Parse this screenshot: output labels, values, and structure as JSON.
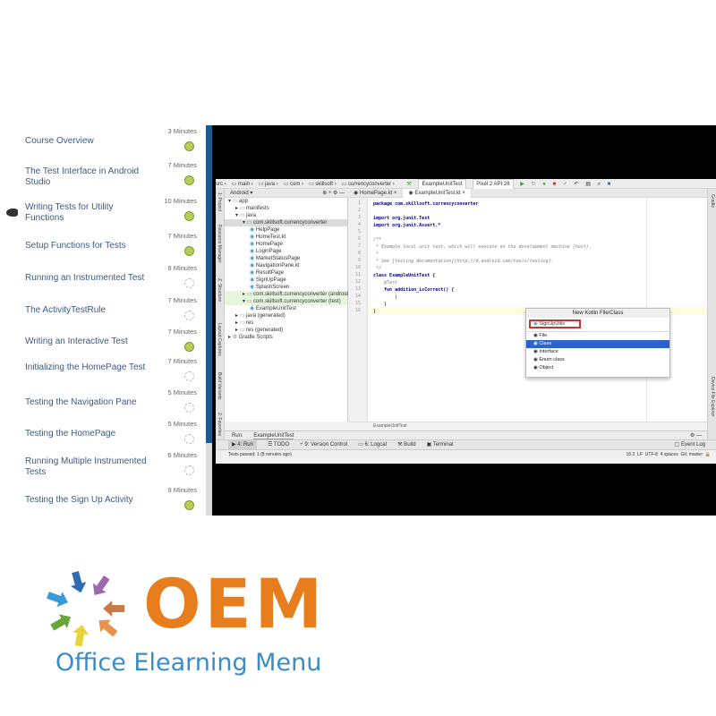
{
  "course_toc": {
    "items": [
      {
        "title": "Course Overview",
        "duration": "3 Minutes",
        "status": "completed"
      },
      {
        "title": "The Test Interface in Android Studio",
        "duration": "7 Minutes",
        "status": "completed"
      },
      {
        "title": "Writing Tests for Utility Functions",
        "duration": "10 Minutes",
        "status": "completed",
        "current": true
      },
      {
        "title": "Setup Functions for Tests",
        "duration": "7 Minutes",
        "status": "completed"
      },
      {
        "title": "Running an Instrumented Test",
        "duration": "8 Minutes",
        "status": "not-started"
      },
      {
        "title": "The ActivityTestRule",
        "duration": "7 Minutes",
        "status": "not-started"
      },
      {
        "title": "Writing an Interactive Test",
        "duration": "7 Minutes",
        "status": "completed"
      },
      {
        "title": "Initializing the HomePage Test",
        "duration": "7 Minutes",
        "status": "not-started"
      },
      {
        "title": "Testing the Navigation Pane",
        "duration": "5 Minutes",
        "status": "not-started"
      },
      {
        "title": "Testing the HomePage",
        "duration": "5 Minutes",
        "status": "not-started"
      },
      {
        "title": "Running Multiple Instrumented Tests",
        "duration": "6 Minutes",
        "status": "not-started"
      },
      {
        "title": "Testing the Sign Up Activity",
        "duration": "9 Minutes",
        "status": "completed"
      }
    ]
  },
  "ide": {
    "breadcrumb": [
      "src",
      "main",
      "java",
      "com",
      "skillsoft",
      "currencyconverter"
    ],
    "run_config": "ExampleUnitTest",
    "device": "Pixel 2 API 28",
    "project_view": "Android",
    "left_tool_tabs": [
      "1: Project",
      "Resource Manager",
      "Z: Structure",
      "Layout Captures",
      "Build Variants",
      "2: Favorites"
    ],
    "right_tool_tabs": [
      "Gradle",
      "Device File Explorer"
    ],
    "tree": [
      {
        "label": "app",
        "indent": 0,
        "icon": "folder",
        "arrow": "▾"
      },
      {
        "label": "manifests",
        "indent": 1,
        "icon": "folder",
        "arrow": "▸"
      },
      {
        "label": "java",
        "indent": 1,
        "icon": "folder",
        "arrow": "▾"
      },
      {
        "label": "com.skillsoft.currencyconverter",
        "indent": 2,
        "icon": "package",
        "arrow": "▾",
        "selected": true
      },
      {
        "label": "HelpPage",
        "indent": 3,
        "icon": "class"
      },
      {
        "label": "HomeTest.kt",
        "indent": 3,
        "icon": "kt"
      },
      {
        "label": "HomePage",
        "indent": 3,
        "icon": "class"
      },
      {
        "label": "LoginPage",
        "indent": 3,
        "icon": "class"
      },
      {
        "label": "MarketStatusPage",
        "indent": 3,
        "icon": "class"
      },
      {
        "label": "NavigationPane.kt",
        "indent": 3,
        "icon": "kt"
      },
      {
        "label": "ResultPage",
        "indent": 3,
        "icon": "class"
      },
      {
        "label": "SignUpPage",
        "indent": 3,
        "icon": "class"
      },
      {
        "label": "SplashScreen",
        "indent": 3,
        "icon": "class"
      },
      {
        "label": "com.skillsoft.currencyconverter (androidTest)",
        "indent": 2,
        "icon": "package",
        "arrow": "▸",
        "test": true
      },
      {
        "label": "com.skillsoft.currencyconverter (test)",
        "indent": 2,
        "icon": "package",
        "arrow": "▾",
        "test": true
      },
      {
        "label": "ExampleUnitTest",
        "indent": 3,
        "icon": "class"
      },
      {
        "label": "java (generated)",
        "indent": 1,
        "icon": "folder",
        "arrow": "▸"
      },
      {
        "label": "res",
        "indent": 1,
        "icon": "folder",
        "arrow": "▸"
      },
      {
        "label": "res (generated)",
        "indent": 1,
        "icon": "folder",
        "arrow": "▸"
      },
      {
        "label": "Gradle Scripts",
        "indent": 0,
        "icon": "gradle",
        "arrow": "▸"
      }
    ],
    "editor_tabs": [
      {
        "label": "HomePage.kt",
        "active": false
      },
      {
        "label": "ExampleUnitTest.kt",
        "active": true
      }
    ],
    "code_lines": [
      {
        "n": "1",
        "text": "package com.skillsoft.currencyconverter",
        "kind": "kw"
      },
      {
        "n": "2",
        "text": "",
        "kind": ""
      },
      {
        "n": "3",
        "text": "import org.junit.Test",
        "kind": "kw"
      },
      {
        "n": "4",
        "text": "import org.junit.Assert.*",
        "kind": "kw"
      },
      {
        "n": "5",
        "text": "",
        "kind": ""
      },
      {
        "n": "6",
        "text": "/**",
        "kind": "cm"
      },
      {
        "n": "7",
        "text": " * Example local unit test, which will execute on the development machine (host).",
        "kind": "cm"
      },
      {
        "n": "8",
        "text": " *",
        "kind": "cm"
      },
      {
        "n": "9",
        "text": " * See [testing documentation](http://d.android.com/tools/testing).",
        "kind": "cm"
      },
      {
        "n": "10",
        "text": " */",
        "kind": "cm"
      },
      {
        "n": "11",
        "text": "class ExampleUnitTest {",
        "kind": "kw"
      },
      {
        "n": "12",
        "text": "    @Test",
        "kind": "cm"
      },
      {
        "n": "13",
        "text": "    fun addition_isCorrect() {",
        "kind": "kw"
      },
      {
        "n": "14",
        "text": "        |",
        "kind": ""
      },
      {
        "n": "15",
        "text": "    }",
        "kind": ""
      },
      {
        "n": "16",
        "text": "}",
        "kind": ""
      }
    ],
    "editor_footer": "ExampleUnitTest",
    "popup": {
      "title": "New Kotlin File/Class",
      "input_value": "SignUpUtils",
      "options": [
        {
          "label": "File",
          "selected": false
        },
        {
          "label": "Class",
          "selected": true
        },
        {
          "label": "Interface",
          "selected": false
        },
        {
          "label": "Enum class",
          "selected": false
        },
        {
          "label": "Object",
          "selected": false
        }
      ]
    },
    "run_bar": {
      "label": "Run:",
      "config": "ExampleUnitTest"
    },
    "bottom_tabs": [
      {
        "label": "▶ 4: Run",
        "active": true
      },
      {
        "label": "☰ TODO",
        "active": false
      },
      {
        "label": "⑂ 9: Version Control",
        "active": false
      },
      {
        "label": "▭ 6: Logcat",
        "active": false
      },
      {
        "label": "⚒ Build",
        "active": false
      },
      {
        "label": "▣ Terminal",
        "active": false
      }
    ],
    "event_log": "Event Log",
    "status": {
      "message": "Tests passed: 1 (8 minutes ago)",
      "position": "16:2",
      "line_sep": "LF",
      "encoding": "UTF-8",
      "indent": "4 spaces",
      "vcs": "Git: master"
    }
  },
  "logo": {
    "brand": "OEM",
    "subtitle": "Office Elearning Menu",
    "arrow_colors": [
      "#c97a4a",
      "#9b6bb0",
      "#2f6db3",
      "#3a9ad9",
      "#66a83a",
      "#e5d43a",
      "#e8924a"
    ],
    "brand_color": "#e87d1e",
    "subtitle_color": "#3a8cc6"
  }
}
